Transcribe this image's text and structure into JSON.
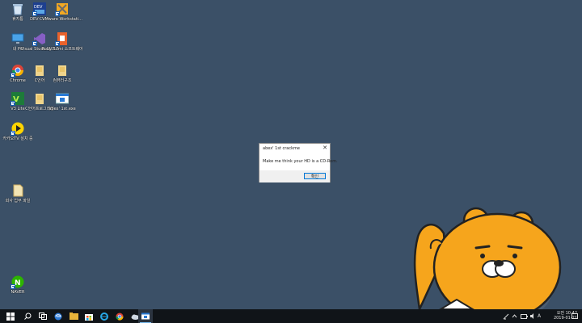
{
  "desktop": {
    "icons": [
      {
        "label": "휴지통"
      },
      {
        "label": "DEV-C++"
      },
      {
        "label": "VMware Workstati..."
      },
      {
        "label": "내 PC"
      },
      {
        "label": "Visual Studio 2017"
      },
      {
        "label": "Ruby Sumi 소프트웨어"
      },
      {
        "label": "Chrome"
      },
      {
        "label": "C언어"
      },
      {
        "label": "컴퓨터구조"
      },
      {
        "label": "V3 Lite"
      },
      {
        "label": "C언어프로그래밍"
      },
      {
        "label": "abex' 1st.exe"
      },
      {
        "label": "카카오TV 설치 중"
      },
      {
        "label": "회사 업무 파일"
      },
      {
        "label": "NAVER"
      }
    ]
  },
  "dialog": {
    "title": "abex' 1st crackme",
    "close": "✕",
    "message": "Make me think your HD is a CD-Rom.",
    "ok_label": "확인"
  },
  "taskbar": {
    "tray_keyboard": "A",
    "clock_time": "오전 10:42",
    "clock_date": "2019-01-21"
  }
}
